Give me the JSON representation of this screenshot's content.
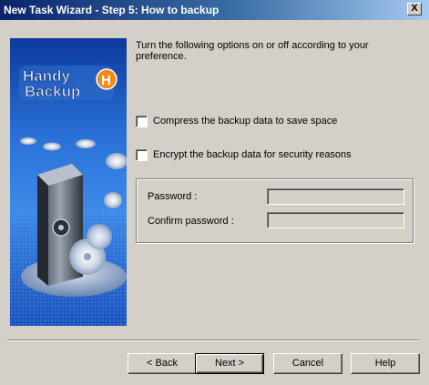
{
  "window": {
    "title": "New Task Wizard - Step 5: How to backup",
    "close_glyph": "X"
  },
  "banner": {
    "logo_line1": "Handy",
    "logo_line2": "Backup",
    "logo_badge": "H"
  },
  "content": {
    "intro": "Turn the following options on or off according to your preference.",
    "options": [
      {
        "label": "Compress the backup data to save space",
        "checked": false
      },
      {
        "label": "Encrypt the backup data for security reasons",
        "checked": false
      }
    ],
    "password": {
      "password_label": "Password :",
      "password_value": "",
      "confirm_label": "Confirm password :",
      "confirm_value": ""
    }
  },
  "buttons": {
    "back": "< Back",
    "next": "Next >",
    "cancel": "Cancel",
    "help": "Help"
  }
}
